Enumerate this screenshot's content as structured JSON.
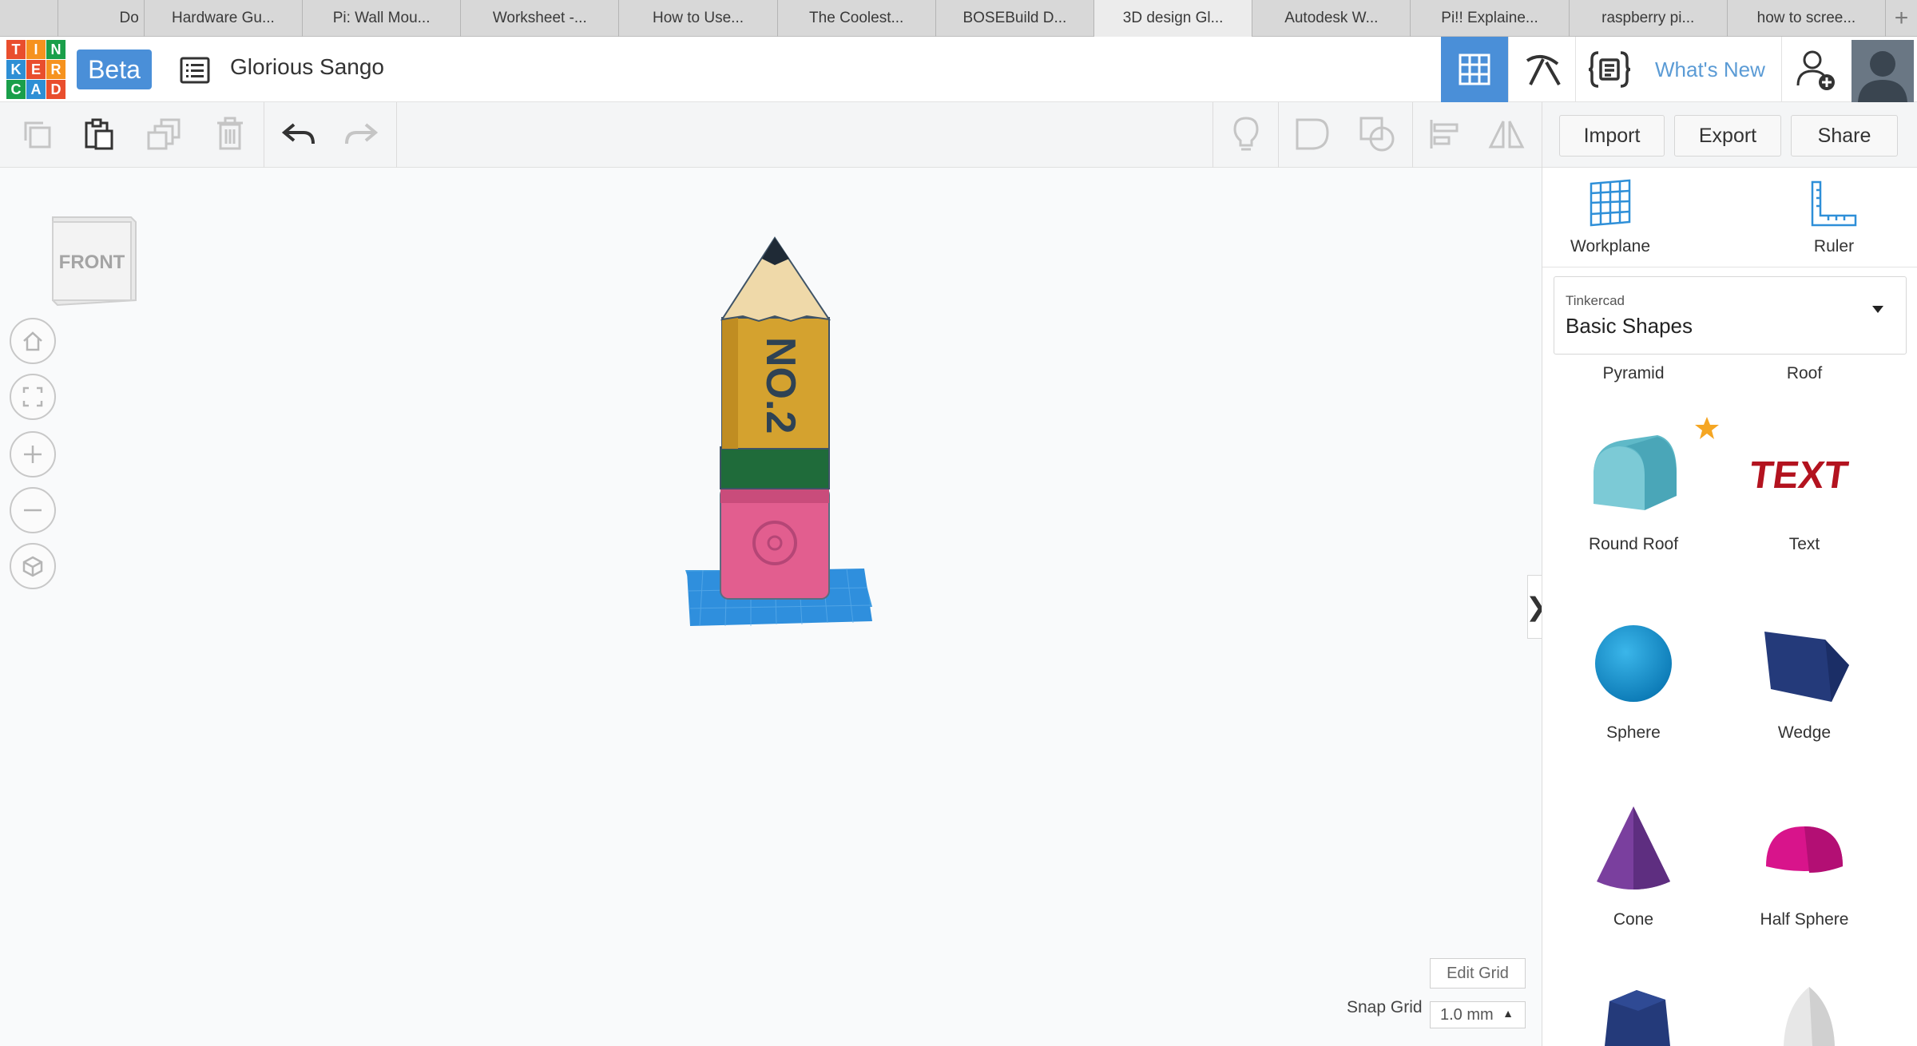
{
  "browser": {
    "tabs": [
      {
        "label": "Do",
        "active": false
      },
      {
        "label": "Hardware Gu...",
        "active": false
      },
      {
        "label": "Pi: Wall Mou...",
        "active": false
      },
      {
        "label": "Worksheet -...",
        "active": false
      },
      {
        "label": "How to Use...",
        "active": false
      },
      {
        "label": "The Coolest...",
        "active": false
      },
      {
        "label": "BOSEBuild D...",
        "active": false
      },
      {
        "label": "3D design Gl...",
        "active": true
      },
      {
        "label": "Autodesk W...",
        "active": false
      },
      {
        "label": "Pi!! Explaine...",
        "active": false
      },
      {
        "label": "raspberry pi...",
        "active": false
      },
      {
        "label": "how to scree...",
        "active": false
      }
    ],
    "new_tab": "+"
  },
  "header": {
    "logo_letters": [
      "T",
      "I",
      "N",
      "K",
      "E",
      "R",
      "C",
      "A",
      "D"
    ],
    "logo_colors": [
      "#e94e2d",
      "#f6921e",
      "#1a9f4a",
      "#2d8fd5",
      "#e94e2d",
      "#f6921e",
      "#1a9f4a",
      "#2d8fd5",
      "#e94e2d"
    ],
    "beta": "Beta",
    "design_title": "Glorious Sango",
    "whats_new": "What's New",
    "accent_color": "#4a8fd8"
  },
  "toolbar": {
    "import": "Import",
    "export": "Export",
    "share": "Share"
  },
  "workspace": {
    "viewcube_face": "FRONT",
    "model_text": "NO.2",
    "edit_grid": "Edit Grid",
    "snap_grid_label": "Snap Grid",
    "snap_grid_value": "1.0 mm",
    "panel_toggle": "❯"
  },
  "panel": {
    "tools": [
      {
        "label": "Workplane",
        "icon": "workplane-icon"
      },
      {
        "label": "Ruler",
        "icon": "ruler-icon"
      }
    ],
    "library": {
      "source": "Tinkercad",
      "category": "Basic Shapes"
    },
    "shapes": [
      {
        "label": "Pyramid"
      },
      {
        "label": "Roof"
      },
      {
        "label": "Round Roof",
        "favorite": true
      },
      {
        "label": "Text"
      },
      {
        "label": "Sphere"
      },
      {
        "label": "Wedge"
      },
      {
        "label": "Cone"
      },
      {
        "label": "Half Sphere"
      }
    ],
    "text_shape_word": "TEXT"
  }
}
